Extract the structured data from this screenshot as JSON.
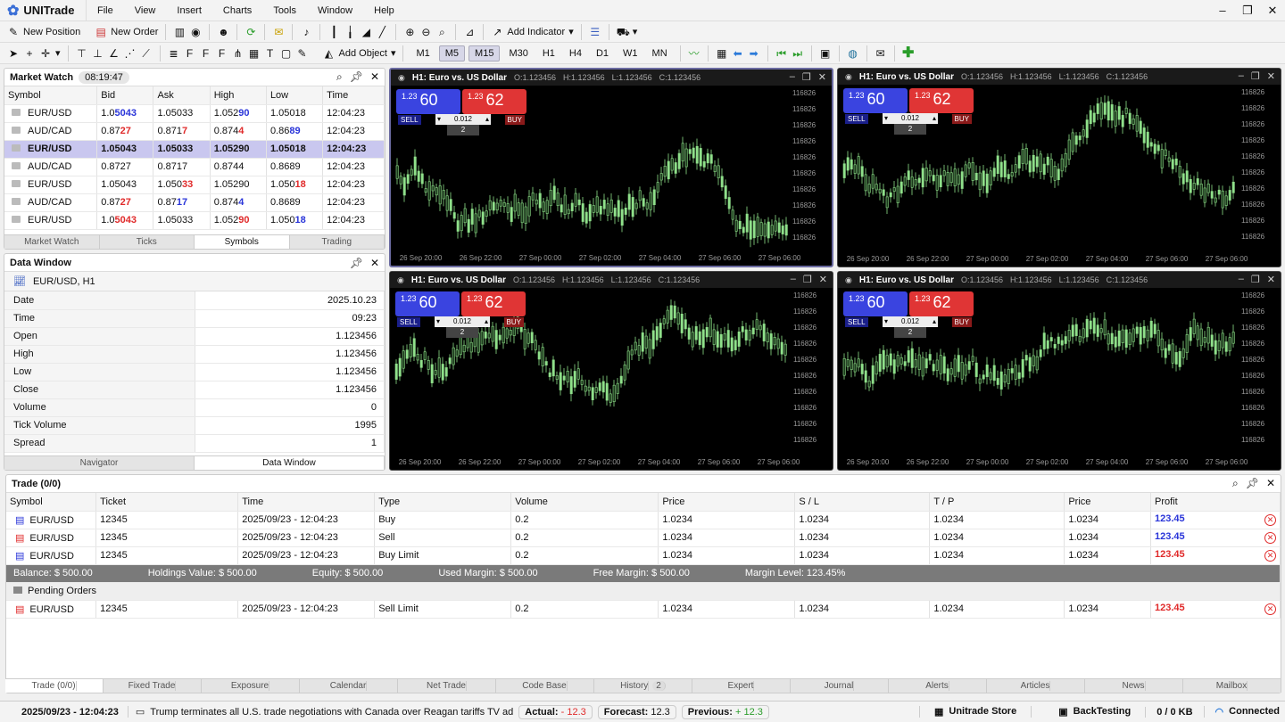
{
  "app": {
    "name": "UNITrade",
    "menus": [
      "File",
      "View",
      "Insert",
      "Charts",
      "Tools",
      "Window",
      "Help"
    ]
  },
  "toolbar1": {
    "new_position": "New Position",
    "new_order": "New Order",
    "add_indicator": "Add Indicator"
  },
  "toolbar2": {
    "add_object": "Add Object",
    "timeframes": [
      "M1",
      "M5",
      "M15",
      "M30",
      "H1",
      "H4",
      "D1",
      "W1",
      "MN"
    ],
    "active_timeframes": [
      "M5",
      "M15"
    ]
  },
  "market_watch": {
    "title": "Market Watch",
    "clock": "08:19:47",
    "columns": [
      "Symbol",
      "Bid",
      "Ask",
      "High",
      "Low",
      "Time"
    ],
    "rows": [
      {
        "symbol": "EUR/USD",
        "bid": [
          "1.0",
          "5043"
        ],
        "ask": "1.05033",
        "high": [
          "1.052",
          "90"
        ],
        "low": "1.05018",
        "time": "12:04:23",
        "bid_c": "up",
        "high_c": "up",
        "low_c": ""
      },
      {
        "symbol": "AUD/CAD",
        "bid": [
          "0.87",
          "27"
        ],
        "ask": "0.8717",
        "high": [
          "0.874",
          "4"
        ],
        "low": "0.8689",
        "time": "12:04:23",
        "bid_c": "dn",
        "high_c": "dn",
        "ask_split": [
          "0.871",
          "7"
        ],
        "ask_c": "dn",
        "low_split": [
          "0.86",
          "89"
        ],
        "low_c": "up"
      },
      {
        "symbol": "EUR/USD",
        "bid": [
          "1.050",
          "43"
        ],
        "ask": "1.05033",
        "high": [
          "1.05290",
          ""
        ],
        "low": "1.05018",
        "time": "12:04:23",
        "sel": true
      },
      {
        "symbol": "AUD/CAD",
        "bid": [
          "0.8727",
          ""
        ],
        "ask": "0.8717",
        "high": [
          "0.8744",
          ""
        ],
        "low": "0.8689",
        "time": "12:04:23"
      },
      {
        "symbol": "EUR/USD",
        "bid": [
          "1.05043",
          ""
        ],
        "ask": "1.05033",
        "high": [
          "1.05290",
          ""
        ],
        "low": "1.05018",
        "time": "12:04:23",
        "ask_split": [
          "1.050",
          "33"
        ],
        "ask_c": "dn",
        "low_split": [
          "1.050",
          "18"
        ],
        "low_c": "dn"
      },
      {
        "symbol": "AUD/CAD",
        "bid": [
          "0.87",
          "27"
        ],
        "ask": "0.8717",
        "high": [
          "0.874",
          "4"
        ],
        "low": "0.8689",
        "time": "12:04:23",
        "bid_c": "dn",
        "high_c": "up",
        "ask_split": [
          "0.87",
          "17"
        ],
        "ask_c": "up"
      },
      {
        "symbol": "EUR/USD",
        "bid": [
          "1.0",
          "5043"
        ],
        "ask": "1.05033",
        "high": [
          "1.052",
          "90"
        ],
        "low": "1.05018",
        "time": "12:04:23",
        "bid_c": "dn",
        "high_c": "dn",
        "low_split": [
          "1.050",
          "18"
        ],
        "low_c": "up"
      }
    ],
    "tabs": [
      "Market Watch",
      "Ticks",
      "Symbols",
      "Trading"
    ],
    "active_tab": "Symbols"
  },
  "data_window": {
    "title": "Data Window",
    "symbol": "EUR/USD, H1",
    "rows": [
      [
        "Date",
        "2025.10.23"
      ],
      [
        "Time",
        "09:23"
      ],
      [
        "Open",
        "1.123456"
      ],
      [
        "High",
        "1.123456"
      ],
      [
        "Low",
        "1.123456"
      ],
      [
        "Close",
        "1.123456"
      ],
      [
        "Volume",
        "0"
      ],
      [
        "Tick Volume",
        "1995"
      ],
      [
        "Spread",
        "1"
      ]
    ],
    "tabs": [
      "Navigator",
      "Data Window"
    ],
    "active_tab": "Data Window"
  },
  "chart": {
    "title": "H1: Euro vs. US Dollar",
    "o": "O:1.123456",
    "h": "H:1.123456",
    "l": "L:1.123456",
    "c": "C:1.123456",
    "sell_prefix": "1.23",
    "sell_big": "60",
    "buy_prefix": "1.23",
    "buy_big": "62",
    "sell": "SELL",
    "buy": "BUY",
    "lot": "0.012",
    "spread": "2",
    "yticks": [
      "116826",
      "116826",
      "116826",
      "116826",
      "116826",
      "116826",
      "116826",
      "116826",
      "116826",
      "116826"
    ],
    "xticks": [
      "26 Sep 20:00",
      "26 Sep 22:00",
      "27 Sep 00:00",
      "27 Sep 02:00",
      "27 Sep 04:00",
      "27 Sep 06:00",
      "27 Sep 06:00"
    ],
    "candle_color": "#8fe08a"
  },
  "trade": {
    "title": "Trade (0/0)",
    "columns": [
      "Symbol",
      "Ticket",
      "Time",
      "Type",
      "Volume",
      "Price",
      "S / L",
      "T / P",
      "Price",
      "Profit"
    ],
    "rows": [
      {
        "symbol": "EUR/USD",
        "ticket": "12345",
        "time": "2025/09/23 - 12:04:23",
        "type": "Buy",
        "volume": "0.2",
        "price": "1.0234",
        "sl": "1.0234",
        "tp": "1.0234",
        "price2": "1.0234",
        "profit": "123.45",
        "pc": "up",
        "icolor": "#2a35d9"
      },
      {
        "symbol": "EUR/USD",
        "ticket": "12345",
        "time": "2025/09/23 - 12:04:23",
        "type": "Sell",
        "volume": "0.2",
        "price": "1.0234",
        "sl": "1.0234",
        "tp": "1.0234",
        "price2": "1.0234",
        "profit": "123.45",
        "pc": "up",
        "icolor": "#e02a2a"
      },
      {
        "symbol": "EUR/USD",
        "ticket": "12345",
        "time": "2025/09/23 - 12:04:23",
        "type": "Buy Limit",
        "volume": "0.2",
        "price": "1.0234",
        "sl": "1.0234",
        "tp": "1.0234",
        "price2": "1.0234",
        "profit": "123.45",
        "pc": "dn",
        "icolor": "#2a35d9"
      }
    ],
    "balance": [
      "Balance: $ 500.00",
      "Holdings Value: $ 500.00",
      "Equity: $ 500.00",
      "Used Margin: $ 500.00",
      "Free Margin: $ 500.00",
      "Margin Level: 123.45%"
    ],
    "pending_label": "Pending Orders",
    "pending": [
      {
        "symbol": "EUR/USD",
        "ticket": "12345",
        "time": "2025/09/23 - 12:04:23",
        "type": "Sell Limit",
        "volume": "0.2",
        "price": "1.0234",
        "sl": "1.0234",
        "tp": "1.0234",
        "price2": "1.0234",
        "profit": "123.45",
        "pc": "dn",
        "icolor": "#e02a2a"
      }
    ],
    "tabs": [
      "Trade (0/0)",
      "Fixed Trade",
      "Exposure",
      "Calendar",
      "Net Trade",
      "Code Base",
      "History",
      "Expert",
      "Journal",
      "Alerts",
      "Articles",
      "News",
      "Mailbox"
    ],
    "history_badge": "2"
  },
  "status": {
    "datetime": "2025/09/23 - 12:04:23",
    "news": "Trump terminates all U.S. trade negotiations with Canada over Reagan tariffs TV ad",
    "actual_label": "Actual:",
    "actual": "- 12.3",
    "forecast_label": "Forecast:",
    "forecast": "12.3",
    "previous_label": "Previous:",
    "previous": "+ 12.3",
    "store": "Unitrade Store",
    "backtesting": "BackTesting",
    "traffic": "0 / 0 KB",
    "connected": "Connected"
  }
}
